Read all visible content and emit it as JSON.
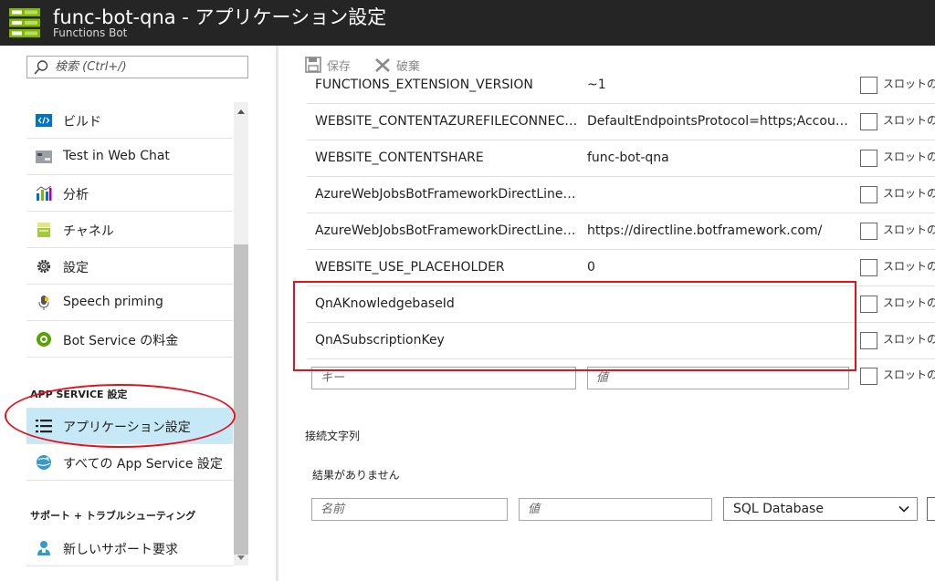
{
  "header": {
    "title": "func-bot-qna - アプリケーション設定",
    "subtitle": "Functions Bot"
  },
  "sidebar": {
    "search_placeholder": "検索 (Ctrl+/)",
    "items": [
      {
        "label": "ビルド",
        "icon": "code-icon"
      },
      {
        "label": "Test in Web Chat",
        "icon": "chat-icon"
      },
      {
        "label": "分析",
        "icon": "chart-icon"
      },
      {
        "label": "チャネル",
        "icon": "channels-icon"
      },
      {
        "label": "設定",
        "icon": "gear-icon"
      },
      {
        "label": "Speech priming",
        "icon": "microphone-icon"
      },
      {
        "label": "Bot Service の料金",
        "icon": "pricing-icon"
      }
    ],
    "app_service_heading": "APP SERVICE 設定",
    "app_service_items": [
      {
        "label": "アプリケーション設定",
        "icon": "list-icon",
        "selected": true
      },
      {
        "label": "すべての App Service 設定",
        "icon": "globe-icon"
      }
    ],
    "support_heading": "サポート + トラブルシューティング",
    "support_items": [
      {
        "label": "新しいサポート要求",
        "icon": "support-person-icon"
      }
    ]
  },
  "toolbar": {
    "save_label": "保存",
    "discard_label": "破棄"
  },
  "app_settings": {
    "slot_label": "スロットの設定",
    "rows": [
      {
        "key": "FUNCTIONS_EXTENSION_VERSION",
        "value": "~1"
      },
      {
        "key": "WEBSITE_CONTENTAZUREFILECONNECTIONSTRING",
        "value": "DefaultEndpointsProtocol=https;AccountName="
      },
      {
        "key": "WEBSITE_CONTENTSHARE",
        "value": "func-bot-qna"
      },
      {
        "key": "AzureWebJobsBotFrameworkDirectLineSecret",
        "value": ""
      },
      {
        "key": "AzureWebJobsBotFrameworkDirectLineEndpoint",
        "value": "https://directline.botframework.com/"
      },
      {
        "key": "WEBSITE_USE_PLACEHOLDER",
        "value": "0"
      },
      {
        "key": "QnAKnowledgebaseId",
        "value": ""
      },
      {
        "key": "QnASubscriptionKey",
        "value": ""
      }
    ],
    "new_key_placeholder": "キー",
    "new_value_placeholder": "値"
  },
  "connection_strings": {
    "heading": "接続文字列",
    "empty_message": "結果がありません",
    "name_placeholder": "名前",
    "value_placeholder": "値",
    "type_selected": "SQL Database"
  },
  "colors": {
    "header_bg": "#252526",
    "selected_bg": "#c7e9f7",
    "highlight_red": "#e0141e"
  }
}
